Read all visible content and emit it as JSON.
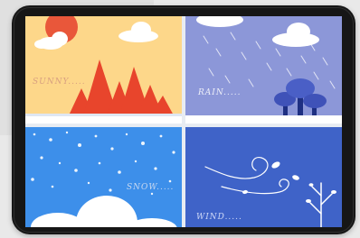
{
  "captions": {
    "sunny": "SUNNY.....",
    "rain": "RAIN.....",
    "snow": "SNOW.....",
    "wind": "WIND....."
  },
  "colors": {
    "sunny_sky": "#fdd78a",
    "sun": "#e9573a",
    "mountains": "#e8452c",
    "rain_sky": "#8c97d8",
    "snow_sky": "#3d8fea",
    "wind_sky": "#3f63c8",
    "ground": "#ffffff",
    "tablet_frame": "#161616"
  }
}
